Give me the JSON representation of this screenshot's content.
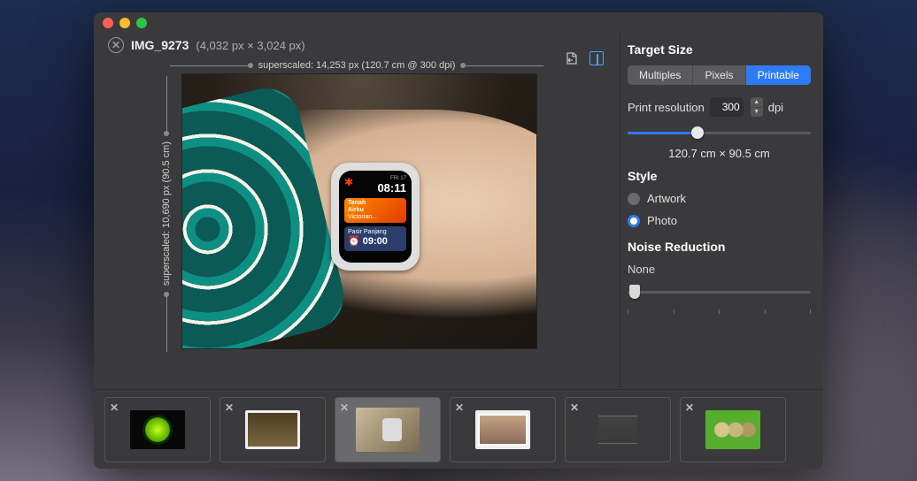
{
  "file": {
    "name": "IMG_9273",
    "dimensions": "(4,032 px × 3,024 px)"
  },
  "rulers": {
    "top": "superscaled: 14,253 px (120.7 cm @ 300 dpi)",
    "left": "superscaled: 10,690 px (90.5 cm)"
  },
  "watch": {
    "day": "FRI 17",
    "time": "08:11",
    "card1_line1": "Tanah",
    "card1_line2": "Airku",
    "card1_line3": "Victorian...",
    "card2_line1": "Pasir Panjang",
    "card2_time": "09:00"
  },
  "panel": {
    "target_title": "Target Size",
    "tabs": {
      "multiples": "Multiples",
      "pixels": "Pixels",
      "printable": "Printable"
    },
    "print_res_label": "Print resolution",
    "print_res_value": "300",
    "dpi": "dpi",
    "size_readout": "120.7 cm × 90.5 cm",
    "style_title": "Style",
    "style_artwork": "Artwork",
    "style_photo": "Photo",
    "noise_title": "Noise Reduction",
    "noise_value": "None"
  }
}
